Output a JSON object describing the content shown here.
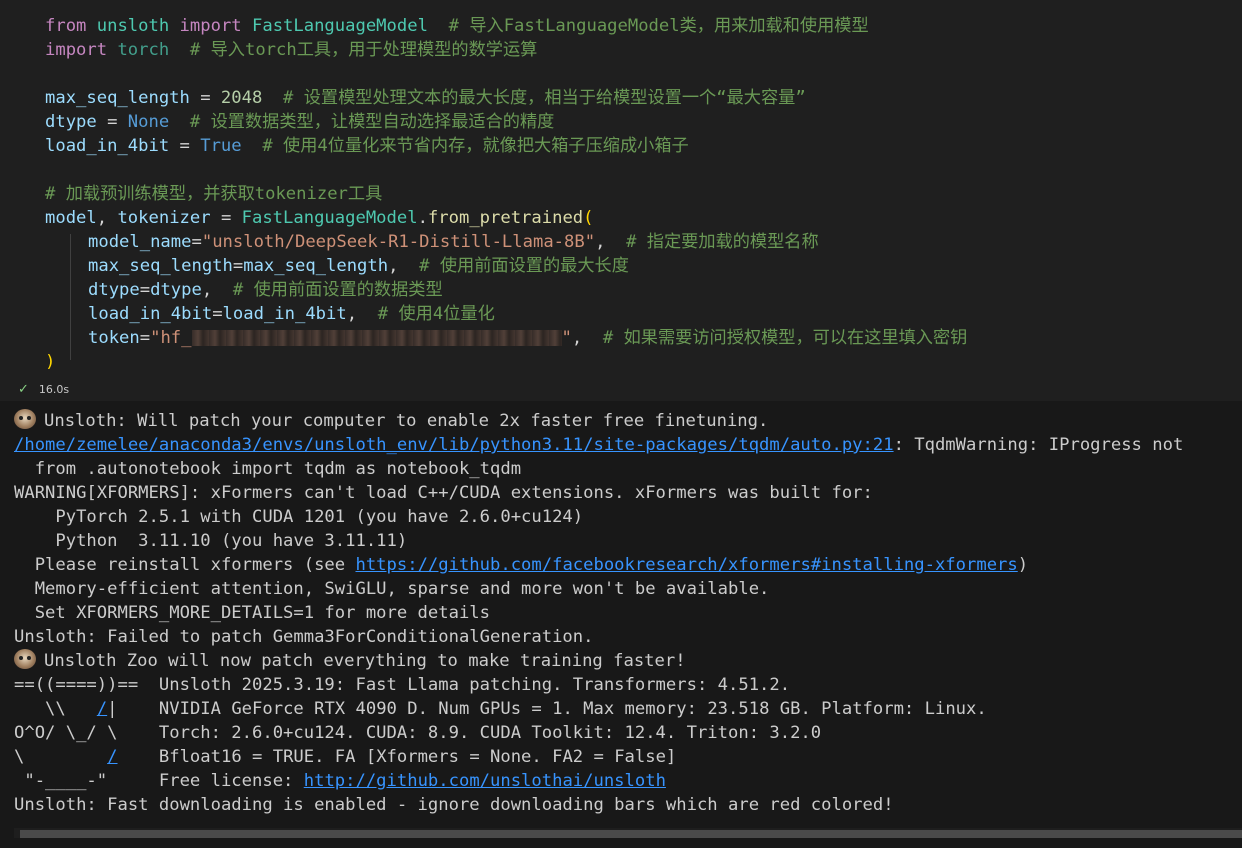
{
  "code": {
    "lines": [
      {
        "parts": [
          "from",
          " unsloth ",
          "import",
          " ",
          "FastLanguageModel",
          "  # 导入FastLanguageModel类，用来加载和使用模型"
        ]
      },
      {
        "parts": [
          "import",
          " ",
          "torch",
          "  # 导入torch工具，用于处理模型的数学运算"
        ]
      },
      {
        "parts": [
          "max_seq_length",
          " = ",
          "2048",
          "  # 设置模型处理文本的最大长度，相当于给模型设置一个“最大容量”"
        ]
      },
      {
        "parts": [
          "dtype",
          " = ",
          "None",
          "  # 设置数据类型，让模型自动选择最适合的精度"
        ]
      },
      {
        "parts": [
          "load_in_4bit",
          " = ",
          "True",
          "  # 使用4位量化来节省内存，就像把大箱子压缩成小箱子"
        ]
      },
      {
        "parts": [
          "# 加载预训练模型，并获取tokenizer工具"
        ]
      },
      {
        "parts": [
          "model",
          ", ",
          "tokenizer",
          " = ",
          "FastLanguageModel",
          ".",
          "from_pretrained",
          "("
        ]
      },
      {
        "parts": [
          "model_name",
          "=",
          "\"unsloth/DeepSeek-R1-Distill-Llama-8B\"",
          ",  ",
          "# 指定要加载的模型名称"
        ]
      },
      {
        "parts": [
          "max_seq_length",
          "=",
          "max_seq_length",
          ",  ",
          "# 使用前面设置的最大长度"
        ]
      },
      {
        "parts": [
          "dtype",
          "=",
          "dtype",
          ",  ",
          "# 使用前面设置的数据类型"
        ]
      },
      {
        "parts": [
          "load_in_4bit",
          "=",
          "load_in_4bit",
          ",  ",
          "# 使用4位量化"
        ]
      },
      {
        "parts": [
          "token",
          "=",
          "\"hf_",
          "\"",
          ",  ",
          "# 如果需要访问授权模型，可以在这里填入密钥"
        ]
      },
      {
        "parts": [
          ")"
        ]
      }
    ]
  },
  "status": {
    "check": "✓",
    "duration": "16.0s"
  },
  "output": {
    "line1": "Unsloth: Will patch your computer to enable 2x faster free finetuning.",
    "line2_link": "/home/zemelee/anaconda3/envs/unsloth_env/lib/python3.11/site-packages/tqdm/auto.py:21",
    "line2_rest": ": TqdmWarning: IProgress not",
    "line3": "  from .autonotebook import tqdm as notebook_tqdm",
    "line4": "WARNING[XFORMERS]: xFormers can't load C++/CUDA extensions. xFormers was built for:",
    "line5": "    PyTorch 2.5.1 with CUDA 1201 (you have 2.6.0+cu124)",
    "line6": "    Python  3.11.10 (you have 3.11.11)",
    "line7_pre": "  Please reinstall xformers (see ",
    "line7_link": "https://github.com/facebookresearch/xformers#installing-xformers",
    "line7_post": ")",
    "line8": "  Memory-efficient attention, SwiGLU, sparse and more won't be available.",
    "line9": "  Set XFORMERS_MORE_DETAILS=1 for more details",
    "line10": "Unsloth: Failed to patch Gemma3ForConditionalGeneration.",
    "line11": "Unsloth Zoo will now patch everything to make training faster!",
    "line12": "==((====))==  Unsloth 2025.3.19: Fast Llama patching. Transformers: 4.51.2.",
    "line13_pre": "   \\\\   ",
    "line13_link": "/",
    "line13_post": "|    NVIDIA GeForce RTX 4090 D. Num GPUs = 1. Max memory: 23.518 GB. Platform: Linux.",
    "line14": "O^O/ \\_/ \\    Torch: 2.6.0+cu124. CUDA: 8.9. CUDA Toolkit: 12.4. Triton: 3.2.0",
    "line15_pre": "\\        ",
    "line15_link": "/",
    "line15_post": "    Bfloat16 = TRUE. FA [Xformers = None. FA2 = False]",
    "line16_pre": " \"-____-\"     Free license: ",
    "line16_link": "http://github.com/unslothai/unsloth",
    "line17": "Unsloth: Fast downloading is enabled - ignore downloading bars which are red colored!"
  }
}
